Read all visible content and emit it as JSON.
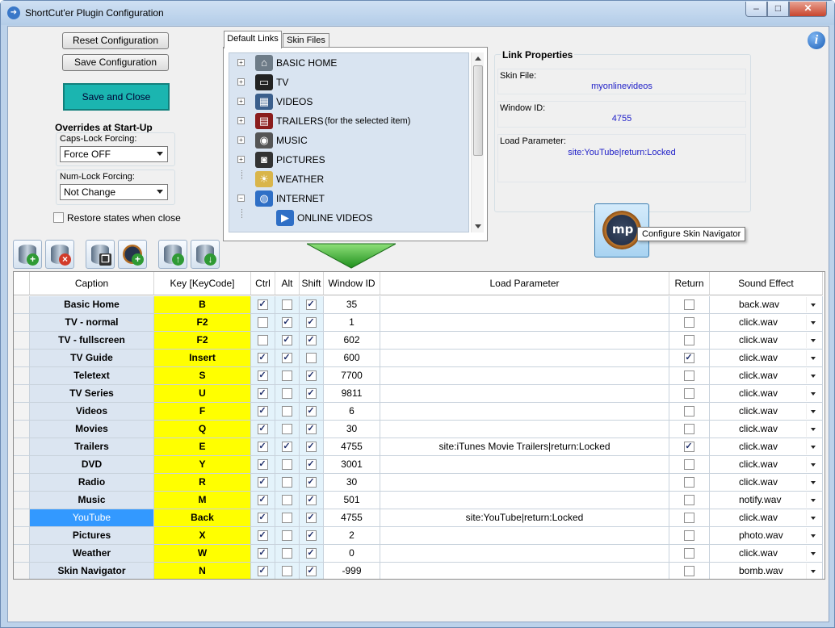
{
  "window": {
    "title": "ShortCut'er Plugin Configuration"
  },
  "left_panel": {
    "reset_label": "Reset Configuration",
    "save_label": "Save Configuration",
    "save_close_label": "Save and Close",
    "overrides_title": "Overrides at Start-Up",
    "caps_label": "Caps-Lock Forcing:",
    "caps_value": "Force OFF",
    "num_label": "Num-Lock Forcing:",
    "num_value": "Not Change",
    "restore_label": "Restore states when close"
  },
  "tabs": [
    "Default Links",
    "Skin Files"
  ],
  "tree": [
    {
      "label": "BASIC HOME",
      "icon": "home-icon",
      "expander": "+"
    },
    {
      "label": "TV",
      "icon": "tv-icon",
      "expander": "+"
    },
    {
      "label": "VIDEOS",
      "icon": "film-icon",
      "expander": "+"
    },
    {
      "label": "TRAILERS",
      "suffix": "(for the selected item)",
      "icon": "trailers-icon",
      "expander": "+"
    },
    {
      "label": "MUSIC",
      "icon": "speaker-icon",
      "expander": "+"
    },
    {
      "label": "PICTURES",
      "icon": "camera-icon",
      "expander": "+"
    },
    {
      "label": "WEATHER",
      "icon": "weather-icon",
      "expander": ""
    },
    {
      "label": "INTERNET",
      "icon": "globe-icon",
      "expander": "-"
    },
    {
      "label": "ONLINE VIDEOS",
      "icon": "online-videos-icon",
      "expander": ""
    }
  ],
  "link_properties": {
    "title": "Link Properties",
    "skin_file_label": "Skin File:",
    "skin_file": "myonlinevideos",
    "window_id_label": "Window ID:",
    "window_id": "4755",
    "load_param_label": "Load Parameter:",
    "load_param": "site:YouTube|return:Locked"
  },
  "skin_navigator_tooltip": "Configure Skin Navigator",
  "toolbar": [
    "add-database-icon",
    "delete-database-icon",
    "copy-database-icon",
    "add-skin-navigator-icon",
    "move-up-icon",
    "move-down-icon"
  ],
  "grid": {
    "columns": [
      "Caption",
      "Key [KeyCode]",
      "Ctrl",
      "Alt",
      "Shift",
      "Window ID",
      "Load Parameter",
      "Return",
      "Sound Effect"
    ],
    "rows": [
      {
        "caption": "Basic Home",
        "key": "B",
        "ctrl": true,
        "alt": false,
        "shift": true,
        "window_id": "35",
        "load": "",
        "ret": false,
        "sound": "back.wav"
      },
      {
        "caption": "TV - normal",
        "key": "F2",
        "ctrl": false,
        "alt": true,
        "shift": true,
        "window_id": "1",
        "load": "",
        "ret": false,
        "sound": "click.wav"
      },
      {
        "caption": "TV - fullscreen",
        "key": "F2",
        "ctrl": false,
        "alt": true,
        "shift": true,
        "window_id": "602",
        "load": "",
        "ret": false,
        "sound": "click.wav"
      },
      {
        "caption": "TV Guide",
        "key": "Insert",
        "ctrl": true,
        "alt": true,
        "shift": false,
        "window_id": "600",
        "load": "",
        "ret": true,
        "sound": "click.wav"
      },
      {
        "caption": "Teletext",
        "key": "S",
        "ctrl": true,
        "alt": false,
        "shift": true,
        "window_id": "7700",
        "load": "",
        "ret": false,
        "sound": "click.wav"
      },
      {
        "caption": "TV Series",
        "key": "U",
        "ctrl": true,
        "alt": false,
        "shift": true,
        "window_id": "9811",
        "load": "",
        "ret": false,
        "sound": "click.wav"
      },
      {
        "caption": "Videos",
        "key": "F",
        "ctrl": true,
        "alt": false,
        "shift": true,
        "window_id": "6",
        "load": "",
        "ret": false,
        "sound": "click.wav"
      },
      {
        "caption": "Movies",
        "key": "Q",
        "ctrl": true,
        "alt": false,
        "shift": true,
        "window_id": "30",
        "load": "",
        "ret": false,
        "sound": "click.wav"
      },
      {
        "caption": "Trailers",
        "key": "E",
        "ctrl": true,
        "alt": true,
        "shift": true,
        "window_id": "4755",
        "load": "site:iTunes Movie Trailers|return:Locked",
        "ret": true,
        "sound": "click.wav"
      },
      {
        "caption": "DVD",
        "key": "Y",
        "ctrl": true,
        "alt": false,
        "shift": true,
        "window_id": "3001",
        "load": "",
        "ret": false,
        "sound": "click.wav"
      },
      {
        "caption": "Radio",
        "key": "R",
        "ctrl": true,
        "alt": false,
        "shift": true,
        "window_id": "30",
        "load": "",
        "ret": false,
        "sound": "click.wav"
      },
      {
        "caption": "Music",
        "key": "M",
        "ctrl": true,
        "alt": false,
        "shift": true,
        "window_id": "501",
        "load": "",
        "ret": false,
        "sound": "notify.wav"
      },
      {
        "caption": "YouTube",
        "key": "Back",
        "ctrl": true,
        "alt": false,
        "shift": true,
        "window_id": "4755",
        "load": "site:YouTube|return:Locked",
        "ret": false,
        "sound": "click.wav",
        "selected": true
      },
      {
        "caption": "Pictures",
        "key": "X",
        "ctrl": true,
        "alt": false,
        "shift": true,
        "window_id": "2",
        "load": "",
        "ret": false,
        "sound": "photo.wav"
      },
      {
        "caption": "Weather",
        "key": "W",
        "ctrl": true,
        "alt": false,
        "shift": true,
        "window_id": "0",
        "load": "",
        "ret": false,
        "sound": "click.wav"
      },
      {
        "caption": "Skin Navigator",
        "key": "N",
        "ctrl": true,
        "alt": false,
        "shift": true,
        "window_id": "-999",
        "load": "",
        "ret": false,
        "sound": "bomb.wav"
      }
    ]
  },
  "colors": {
    "key_cell": "#ffff00",
    "caption_cell": "#dbe5f1",
    "selected": "#3399ff",
    "save_close": "#1bb5b0",
    "check_col": "#e4f3fb"
  }
}
